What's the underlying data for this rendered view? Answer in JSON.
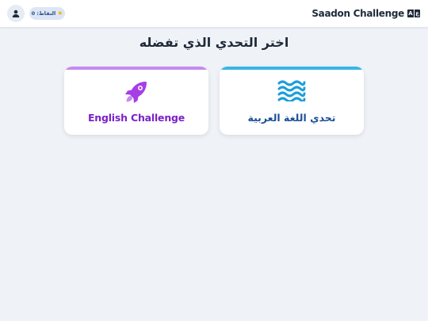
{
  "header": {
    "brand_title": "Saadon Challenge",
    "brand_logo_letters": [
      "A",
      "ع"
    ],
    "points_label": "النقاط: 0",
    "points_icon": "star-icon",
    "user_icon": "user-icon"
  },
  "main": {
    "title": "اختر التحدي الذي تفضله",
    "cards": [
      {
        "label": "تحدي اللغة العربية",
        "icon": "water-waves-icon",
        "accent": "#38b5e8",
        "text_color": "#1e4f96"
      },
      {
        "label": "English Challenge",
        "icon": "rocket-icon",
        "accent": "#c58af0",
        "text_color": "#7a22c9"
      }
    ]
  },
  "colors": {
    "background": "#eff3f7",
    "header_bg": "#ffffff",
    "badge_bg": "#dde6f5",
    "star": "#f5b100",
    "title_text": "#1f2a3a"
  }
}
